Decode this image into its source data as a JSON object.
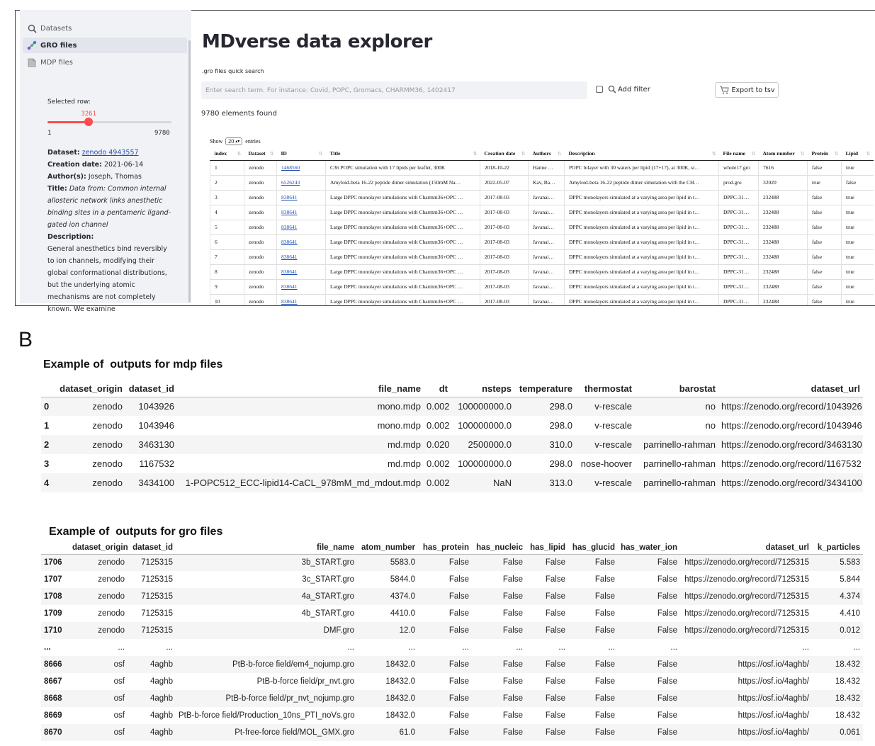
{
  "figure": {
    "panel_a_label": "A",
    "panel_b_label": "B"
  },
  "sidebar": {
    "nav": [
      {
        "label": "Datasets",
        "icon": "magnifier-icon",
        "active": false
      },
      {
        "label": "GRO files",
        "icon": "molecule-icon",
        "active": true
      },
      {
        "label": "MDP files",
        "icon": "document-icon",
        "active": false
      }
    ],
    "selected_row_label": "Selected row:",
    "slider": {
      "min": 1,
      "max": 9780,
      "value": 3261,
      "min_label": "1",
      "max_label": "9780",
      "value_label": "3261",
      "accent": "#ff4b4b"
    },
    "details": {
      "dataset_key": "Dataset:",
      "dataset_value": "zenodo 4943557",
      "creation_key": "Creation date:",
      "creation_value": "2021-06-14",
      "authors_key": "Author(s):",
      "authors_value": "Joseph, Thomas",
      "title_key": "Title:",
      "title_value": "Data from: Common internal allosteric network links anesthetic binding sites in a pentameric ligand-gated ion channel",
      "description_key": "Description:",
      "description_value": "General anesthetics bind reversibly to ion channels, modifying their global conformational distributions, but the underlying atomic mechanisms are not completely known. We examine"
    }
  },
  "main": {
    "title": "MDverse data explorer",
    "search_label": ".gro files quick search",
    "search_placeholder": "Enter search term. For instance: Covid, POPC, Gromacs, CHARMM36, 1402417",
    "filter_label": "Add filter",
    "export_label": "Export to tsv",
    "found_text": "9780 elements found",
    "show_prefix": "Show",
    "show_value": "20",
    "show_suffix": "entries",
    "table": {
      "headers": [
        "index",
        "Dataset",
        "ID",
        "Title",
        "Creation date",
        "Authors",
        "Description",
        "File name",
        "Atom number",
        "Protein",
        "Lipid"
      ],
      "rows": [
        [
          "1",
          "zenodo",
          "1468560",
          "C36 POPC simulation with 17 lipids per leaflet, 300K",
          "2018-10-22",
          "Hanne …",
          "POPC bilayer with 30 waters per lipid (17+17), at 300K, si…",
          "whole17.gro",
          "7616",
          "false",
          "true"
        ],
        [
          "2",
          "zenodo",
          "6526243",
          "Amyloid-beta 16-22 peptide dimer simulation (150mM Na…",
          "2022-05-07",
          "Kav, Ba…",
          "Amyloid-beta 16-22 peptide dimer simulation with the CH…",
          "prod.gro",
          "32020",
          "true",
          "false"
        ],
        [
          "3",
          "zenodo",
          "838641",
          "Large DPPC monolayer simulations with Charmm36+OPC …",
          "2017-08-03",
          "Javanai…",
          "DPPC monolayers simulated at a varying area per lipid in t…",
          "DPPC-31…",
          "232488",
          "false",
          "true"
        ],
        [
          "4",
          "zenodo",
          "838641",
          "Large DPPC monolayer simulations with Charmm36+OPC …",
          "2017-08-03",
          "Javanai…",
          "DPPC monolayers simulated at a varying area per lipid in t…",
          "DPPC-31…",
          "232488",
          "false",
          "true"
        ],
        [
          "5",
          "zenodo",
          "838641",
          "Large DPPC monolayer simulations with Charmm36+OPC …",
          "2017-08-03",
          "Javanai…",
          "DPPC monolayers simulated at a varying area per lipid in t…",
          "DPPC-31…",
          "232488",
          "false",
          "true"
        ],
        [
          "6",
          "zenodo",
          "838641",
          "Large DPPC monolayer simulations with Charmm36+OPC …",
          "2017-08-03",
          "Javanai…",
          "DPPC monolayers simulated at a varying area per lipid in t…",
          "DPPC-31…",
          "232488",
          "false",
          "true"
        ],
        [
          "7",
          "zenodo",
          "838641",
          "Large DPPC monolayer simulations with Charmm36+OPC …",
          "2017-08-03",
          "Javanai…",
          "DPPC monolayers simulated at a varying area per lipid in t…",
          "DPPC-31…",
          "232488",
          "false",
          "true"
        ],
        [
          "8",
          "zenodo",
          "838641",
          "Large DPPC monolayer simulations with Charmm36+OPC …",
          "2017-08-03",
          "Javanai…",
          "DPPC monolayers simulated at a varying area per lipid in t…",
          "DPPC-31…",
          "232488",
          "false",
          "true"
        ],
        [
          "9",
          "zenodo",
          "838641",
          "Large DPPC monolayer simulations with Charmm36+OPC …",
          "2017-08-03",
          "Javanai…",
          "DPPC monolayers simulated at a varying area per lipid in t…",
          "DPPC-31…",
          "232488",
          "false",
          "true"
        ],
        [
          "10",
          "zenodo",
          "838641",
          "Large DPPC monolayer simulations with Charmm36+OPC …",
          "2017-08-03",
          "Javanai…",
          "DPPC monolayers simulated at a varying area per lipid in t…",
          "DPPC-31…",
          "232488",
          "false",
          "true"
        ]
      ]
    }
  },
  "mdp_section": {
    "title": "Example of  outputs for mdp files",
    "headers": [
      "",
      "dataset_origin",
      "dataset_id",
      "file_name",
      "dt",
      "nsteps",
      "temperature",
      "thermostat",
      "barostat",
      "dataset_url"
    ],
    "rows": [
      [
        "0",
        "zenodo",
        "1043926",
        "mono.mdp",
        "0.002",
        "100000000.0",
        "298.0",
        "v-rescale",
        "no",
        "https://zenodo.org/record/1043926"
      ],
      [
        "1",
        "zenodo",
        "1043946",
        "mono.mdp",
        "0.002",
        "100000000.0",
        "298.0",
        "v-rescale",
        "no",
        "https://zenodo.org/record/1043946"
      ],
      [
        "2",
        "zenodo",
        "3463130",
        "md.mdp",
        "0.020",
        "2500000.0",
        "310.0",
        "v-rescale",
        "parrinello-rahman",
        "https://zenodo.org/record/3463130"
      ],
      [
        "3",
        "zenodo",
        "1167532",
        "md.mdp",
        "0.002",
        "100000000.0",
        "298.0",
        "nose-hoover",
        "parrinello-rahman",
        "https://zenodo.org/record/1167532"
      ],
      [
        "4",
        "zenodo",
        "3434100",
        "1-POPC512_ECC-lipid14-CaCL_978mM_md_mdout.mdp",
        "0.002",
        "NaN",
        "313.0",
        "v-rescale",
        "parrinello-rahman",
        "https://zenodo.org/record/3434100"
      ]
    ]
  },
  "gro_section": {
    "title": "Example of  outputs for gro files",
    "headers": [
      "",
      "dataset_origin",
      "dataset_id",
      "file_name",
      "atom_number",
      "has_protein",
      "has_nucleic",
      "has_lipid",
      "has_glucid",
      "has_water_ion",
      "dataset_url",
      "k_particles"
    ],
    "rows": [
      [
        "1706",
        "zenodo",
        "7125315",
        "3b_START.gro",
        "5583.0",
        "False",
        "False",
        "False",
        "False",
        "False",
        "https://zenodo.org/record/7125315",
        "5.583"
      ],
      [
        "1707",
        "zenodo",
        "7125315",
        "3c_START.gro",
        "5844.0",
        "False",
        "False",
        "False",
        "False",
        "False",
        "https://zenodo.org/record/7125315",
        "5.844"
      ],
      [
        "1708",
        "zenodo",
        "7125315",
        "4a_START.gro",
        "4374.0",
        "False",
        "False",
        "False",
        "False",
        "False",
        "https://zenodo.org/record/7125315",
        "4.374"
      ],
      [
        "1709",
        "zenodo",
        "7125315",
        "4b_START.gro",
        "4410.0",
        "False",
        "False",
        "False",
        "False",
        "False",
        "https://zenodo.org/record/7125315",
        "4.410"
      ],
      [
        "1710",
        "zenodo",
        "7125315",
        "DMF.gro",
        "12.0",
        "False",
        "False",
        "False",
        "False",
        "False",
        "https://zenodo.org/record/7125315",
        "0.012"
      ],
      [
        "...",
        "...",
        "...",
        "...",
        "...",
        "...",
        "...",
        "...",
        "...",
        "...",
        "...",
        "..."
      ],
      [
        "8666",
        "osf",
        "4aghb",
        "PtB-b-force field/em4_nojump.gro",
        "18432.0",
        "False",
        "False",
        "False",
        "False",
        "False",
        "https://osf.io/4aghb/",
        "18.432"
      ],
      [
        "8667",
        "osf",
        "4aghb",
        "PtB-b-force field/pr_nvt.gro",
        "18432.0",
        "False",
        "False",
        "False",
        "False",
        "False",
        "https://osf.io/4aghb/",
        "18.432"
      ],
      [
        "8668",
        "osf",
        "4aghb",
        "PtB-b-force field/pr_nvt_nojump.gro",
        "18432.0",
        "False",
        "False",
        "False",
        "False",
        "False",
        "https://osf.io/4aghb/",
        "18.432"
      ],
      [
        "8669",
        "osf",
        "4aghb",
        "PtB-b-force field/Production_10ns_PTI_noVs.gro",
        "18432.0",
        "False",
        "False",
        "False",
        "False",
        "False",
        "https://osf.io/4aghb/",
        "18.432"
      ],
      [
        "8670",
        "osf",
        "4aghb",
        "Pt-free-force field/MOL_GMX.gro",
        "61.0",
        "False",
        "False",
        "False",
        "False",
        "False",
        "https://osf.io/4aghb/",
        "0.061"
      ]
    ]
  }
}
